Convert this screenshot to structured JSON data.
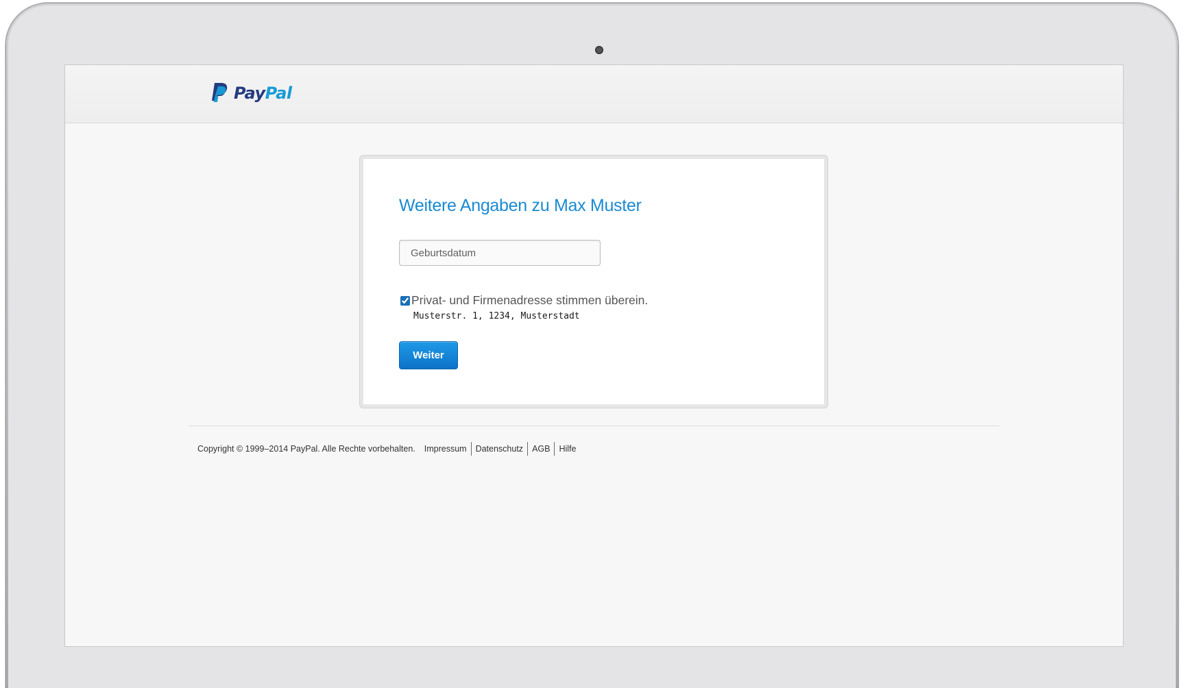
{
  "brand": {
    "logo_icon": "paypal-p-icon",
    "name_part1": "Pay",
    "name_part2": "Pal",
    "colors": {
      "dark_blue": "#253b80",
      "light_blue": "#179bd7"
    }
  },
  "form": {
    "title": "Weitere Angaben zu Max Muster",
    "birthdate_placeholder": "Geburtsdatum",
    "birthdate_value": "",
    "address_checkbox_checked": true,
    "address_checkbox_label": "Privat- und Firmenadresse stimmen überein.",
    "address": "Musterstr. 1, 1234, Musterstadt",
    "submit_label": "Weiter"
  },
  "footer": {
    "copyright": "Copyright © 1999–2014 PayPal. Alle Rechte vorbehalten.",
    "links": [
      "Impressum",
      "Datenschutz",
      "AGB",
      "Hilfe"
    ]
  },
  "colors": {
    "accent": "#1a8ad2",
    "button": "#0d72c9",
    "page_background": "#f7f7f7"
  }
}
